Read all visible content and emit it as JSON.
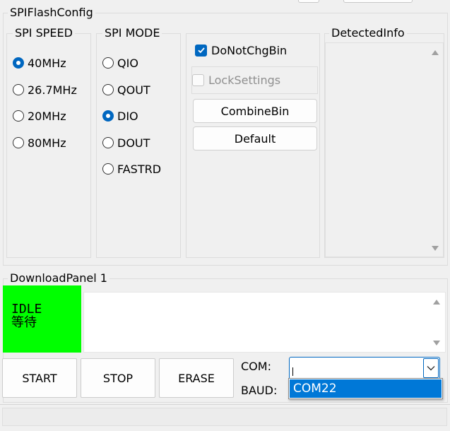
{
  "spi_flash_config": {
    "title": "SPIFlashConfig",
    "spi_speed": {
      "title": "SPI SPEED",
      "options": [
        {
          "label": "40MHz",
          "checked": true
        },
        {
          "label": "26.7MHz",
          "checked": false
        },
        {
          "label": "20MHz",
          "checked": false
        },
        {
          "label": "80MHz",
          "checked": false
        }
      ]
    },
    "spi_mode": {
      "title": "SPI MODE",
      "options": [
        {
          "label": "QIO",
          "checked": false
        },
        {
          "label": "QOUT",
          "checked": false
        },
        {
          "label": "DIO",
          "checked": true
        },
        {
          "label": "DOUT",
          "checked": false
        },
        {
          "label": "FASTRD",
          "checked": false
        }
      ]
    },
    "do_not_chg_bin": {
      "label": "DoNotChgBin",
      "checked": true
    },
    "lock_settings": {
      "label": "LockSettings",
      "checked": false,
      "disabled": true
    },
    "combine_bin_label": "CombineBin",
    "default_label": "Default",
    "detected_info": {
      "title": "DetectedInfo"
    }
  },
  "download_panel": {
    "title": "DownloadPanel 1",
    "status": {
      "line1": "IDLE",
      "line2": "等待",
      "color": "#00ff00"
    },
    "start_label": "START",
    "stop_label": "STOP",
    "erase_label": "ERASE",
    "com_label": "COM:",
    "baud_label": "BAUD:",
    "com_dropdown": {
      "selected": "",
      "options": [
        "COM22"
      ]
    }
  },
  "colors": {
    "accent": "#0067c0",
    "highlight": "#0078d7",
    "status_idle": "#00ff00",
    "background": "#f0f0f0"
  },
  "icons": {
    "scroll_up": "scroll-up-arrow-icon",
    "scroll_down": "scroll-down-arrow-icon",
    "combo_chevron": "chevron-down-icon",
    "checkmark": "checkmark-icon"
  }
}
